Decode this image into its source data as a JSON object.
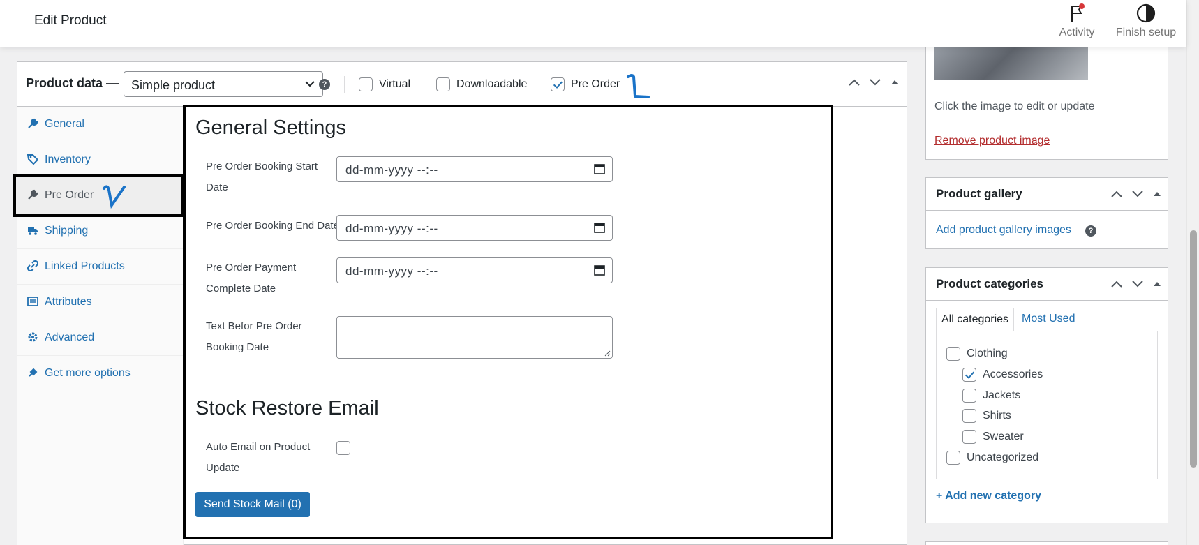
{
  "header": {
    "title": "Edit Product",
    "actions": [
      {
        "label": "Activity",
        "icon": "flag-icon"
      },
      {
        "label": "Finish setup",
        "icon": "half-circle-icon"
      }
    ]
  },
  "product_data": {
    "title": "Product data —",
    "product_type": "Simple product",
    "options": [
      {
        "label": "Virtual",
        "checked": false
      },
      {
        "label": "Downloadable",
        "checked": false
      },
      {
        "label": "Pre Order",
        "checked": true
      }
    ],
    "tabs": [
      {
        "label": "General",
        "icon": "wrench-icon",
        "active": false
      },
      {
        "label": "Inventory",
        "icon": "tag-icon",
        "active": false
      },
      {
        "label": "Pre Order",
        "icon": "wrench-icon",
        "active": true
      },
      {
        "label": "Shipping",
        "icon": "truck-icon",
        "active": false
      },
      {
        "label": "Linked Products",
        "icon": "link-icon",
        "active": false
      },
      {
        "label": "Attributes",
        "icon": "list-icon",
        "active": false
      },
      {
        "label": "Advanced",
        "icon": "gear-icon",
        "active": false
      },
      {
        "label": "Get more options",
        "icon": "plugin-icon",
        "active": false
      }
    ],
    "general_settings": {
      "heading": "General Settings",
      "fields": [
        {
          "label": "Pre Order Booking Start Date",
          "value": "dd-mm-yyyy --:--"
        },
        {
          "label": "Pre Order Booking End Date",
          "value": "dd-mm-yyyy --:--"
        },
        {
          "label": "Pre Order Payment Complete Date",
          "value": "dd-mm-yyyy --:--"
        },
        {
          "label": "Text Befor Pre Order Booking Date",
          "value": ""
        }
      ]
    },
    "stock_restore": {
      "heading": "Stock Restore Email",
      "auto_email_label": "Auto Email on Product Update",
      "auto_email_checked": false,
      "send_button": "Send Stock Mail (0)"
    }
  },
  "sidebar": {
    "product_image": {
      "hint": "Click the image to edit or update",
      "remove_link": "Remove product image"
    },
    "gallery": {
      "title": "Product gallery",
      "add_link": "Add product gallery images"
    },
    "categories": {
      "title": "Product categories",
      "tabs": [
        "All categories",
        "Most Used"
      ],
      "items": [
        {
          "label": "Clothing",
          "checked": false,
          "indent": 0
        },
        {
          "label": "Accessories",
          "checked": true,
          "indent": 1
        },
        {
          "label": "Jackets",
          "checked": false,
          "indent": 1
        },
        {
          "label": "Shirts",
          "checked": false,
          "indent": 1
        },
        {
          "label": "Sweater",
          "checked": false,
          "indent": 1
        },
        {
          "label": "Uncategorized",
          "checked": false,
          "indent": 0
        }
      ],
      "add_link": "+ Add new category"
    }
  },
  "annotations": [
    "1",
    "2"
  ],
  "colors": {
    "accent": "#2271b1",
    "danger": "#b32d2e",
    "annotation": "#1a73c8"
  }
}
